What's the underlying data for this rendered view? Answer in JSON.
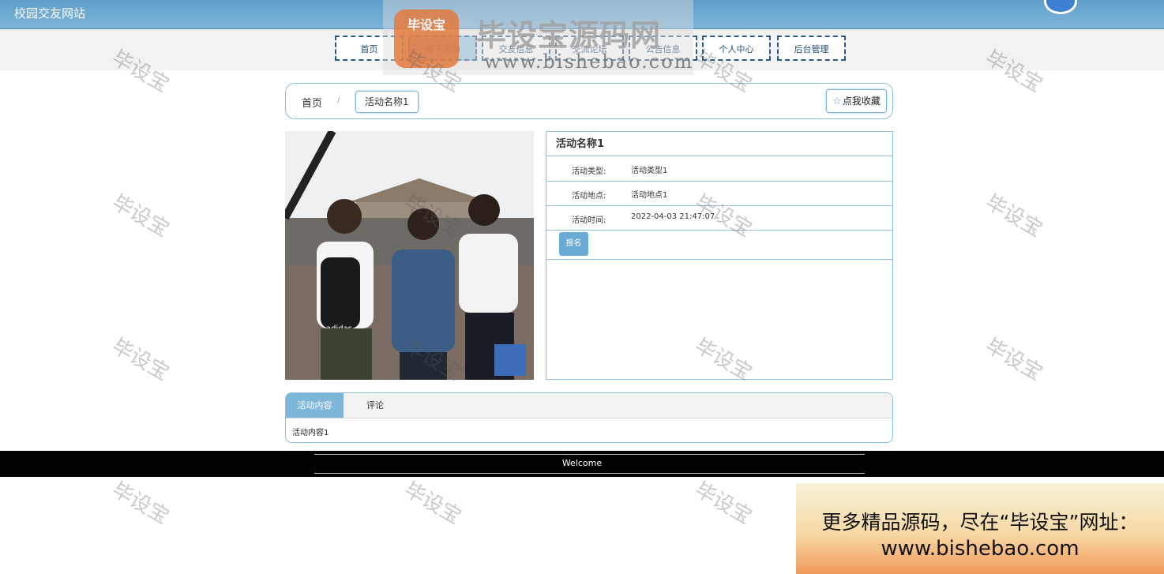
{
  "header": {
    "site_title": "校园交友网站"
  },
  "nav": {
    "items": [
      {
        "label": "首页",
        "active": false
      },
      {
        "label": "线下活动",
        "active": true
      },
      {
        "label": "交友信息",
        "active": false
      },
      {
        "label": "交流论坛",
        "active": false
      },
      {
        "label": "公告信息",
        "active": false
      },
      {
        "label": "个人中心",
        "active": false
      },
      {
        "label": "后台管理",
        "active": false
      }
    ]
  },
  "breadcrumb": {
    "home": "首页",
    "separator": "/",
    "current": "活动名称1"
  },
  "favorite": {
    "icon": "star-outline-icon",
    "label": "点我收藏"
  },
  "activity": {
    "title": "活动名称1",
    "rows": [
      {
        "key": "活动类型:",
        "value": "活动类型1"
      },
      {
        "key": "活动地点:",
        "value": "活动地点1"
      },
      {
        "key": "活动时间:",
        "value": "2022-04-03 21:47:07"
      }
    ],
    "signup_label": "报名"
  },
  "tabs": {
    "items": [
      {
        "label": "活动内容",
        "active": true
      },
      {
        "label": "评论",
        "active": false
      }
    ],
    "content": "活动内容1"
  },
  "footer": {
    "text": "Welcome"
  },
  "watermark": {
    "text": "毕设宝",
    "logo_badge": "毕设宝",
    "logo_title": "毕设宝源码网",
    "logo_url": "www.bishebao.com"
  },
  "ad": {
    "line1": "更多精品源码，尽在“毕设宝”网址：",
    "line2": "www.bishebao.com"
  },
  "colors": {
    "accent": "#7eb6da",
    "nav_border": "#2a5a8a",
    "footer_bg": "#000000"
  }
}
